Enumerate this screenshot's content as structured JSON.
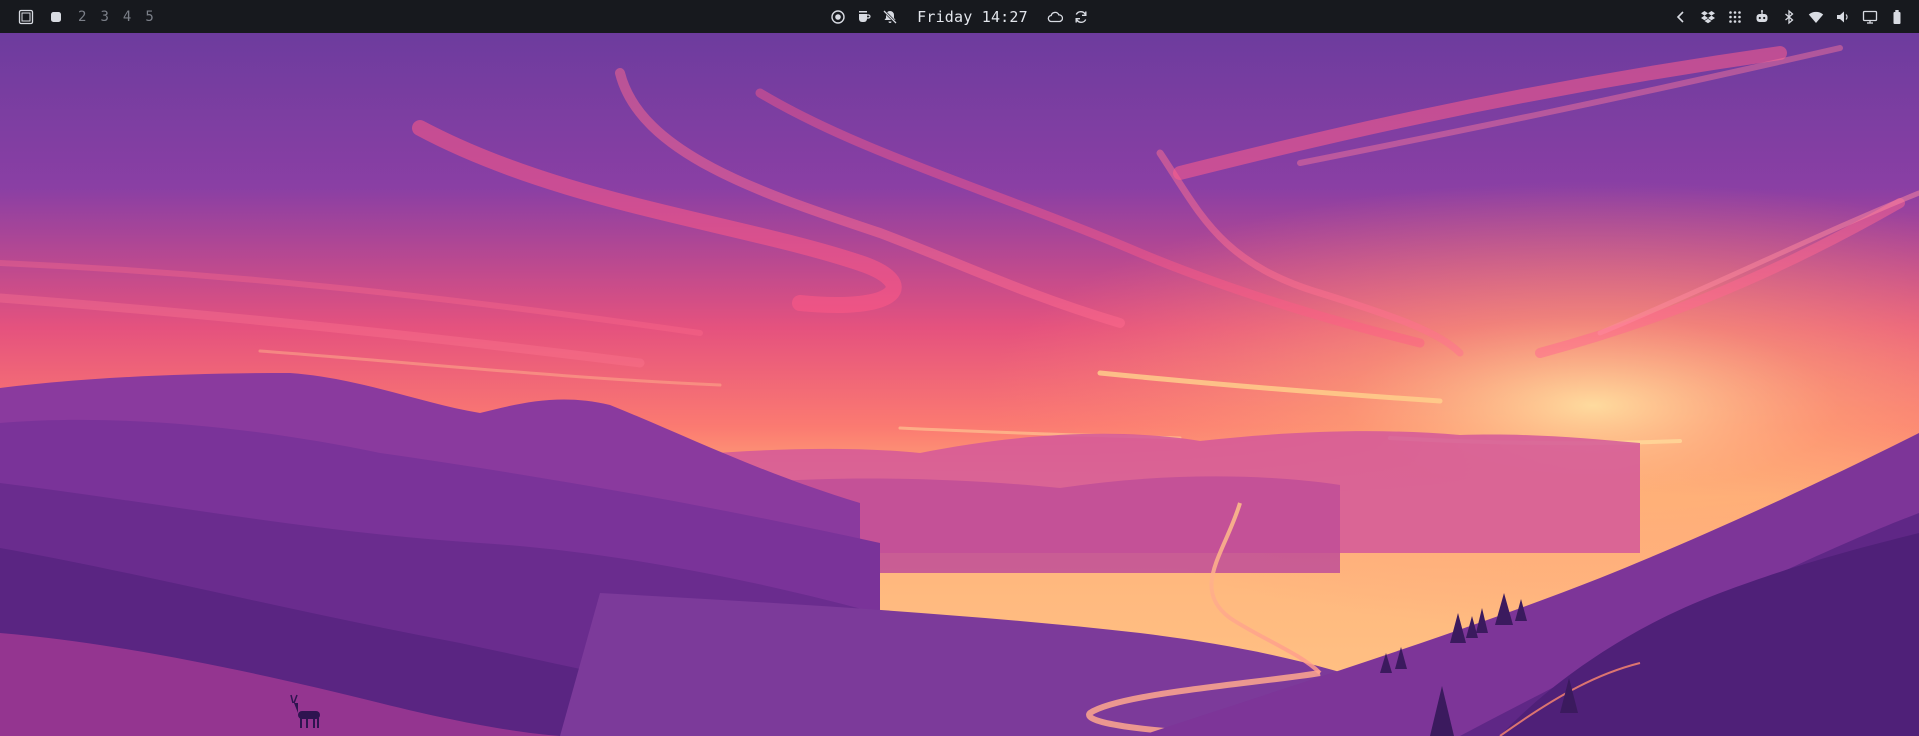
{
  "topbar": {
    "left": {
      "layout_icon": "window-layout-icon",
      "active_workspace_icon": "active-workspace-icon",
      "workspaces": [
        "2",
        "3",
        "4",
        "5"
      ]
    },
    "center": {
      "icons": [
        "record-icon",
        "coffee-icon",
        "notifications-muted-icon"
      ],
      "clock": "Friday 14:27",
      "trailing_icons": [
        "weather-cloud-icon",
        "refresh-icon"
      ]
    },
    "right": {
      "tray_icons": [
        "chevron-left-icon",
        "dropbox-icon",
        "grid-apps-icon",
        "bot-icon",
        "bluetooth-icon",
        "wifi-icon",
        "volume-icon",
        "display-icon",
        "battery-icon"
      ]
    }
  },
  "wallpaper": {
    "description_icon": "sunset-valley-wallpaper"
  },
  "colors": {
    "bar_bg": "#17191e",
    "bar_fg": "#d8dbe2",
    "workspace_inactive": "#7b7f88"
  }
}
